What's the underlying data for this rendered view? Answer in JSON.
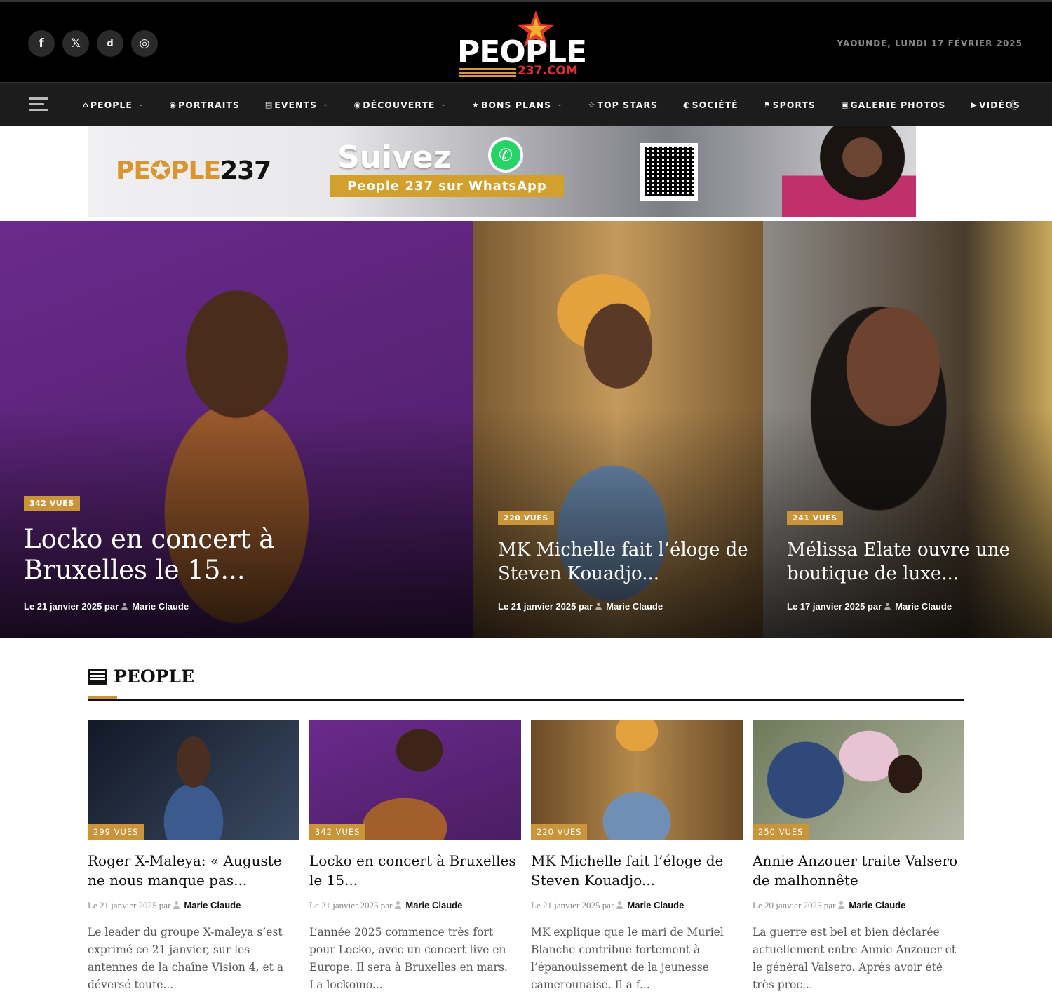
{
  "header": {
    "social": [
      {
        "icon": "facebook-icon",
        "glyph": "f"
      },
      {
        "icon": "x-icon",
        "glyph": "𝕏"
      },
      {
        "icon": "dailymotion-icon",
        "glyph": "d"
      },
      {
        "icon": "instagram-icon",
        "glyph": "◎"
      }
    ],
    "logo_word": "PEOPLE",
    "logo_domain": "237.COM",
    "date": "YAOUNDÉ, LUNDI 17 FÉVRIER 2025"
  },
  "nav": {
    "items": [
      {
        "icon": "⌂",
        "label": "PEOPLE",
        "dropdown": "⌄"
      },
      {
        "icon": "◉",
        "label": "PORTRAITS"
      },
      {
        "icon": "▤",
        "label": "EVENTS",
        "dropdown": "⌄"
      },
      {
        "icon": "◉",
        "label": "DÉCOUVERTE",
        "dropdown": "⌄"
      },
      {
        "icon": "★",
        "label": "BONS PLANS",
        "dropdown": "⌄"
      },
      {
        "icon": "☆",
        "label": "TOP STARS"
      },
      {
        "icon": "◐",
        "label": "SOCIÉTÉ"
      },
      {
        "icon": "⚑",
        "label": "SPORTS"
      },
      {
        "icon": "▣",
        "label": "GALERIE PHOTOS"
      },
      {
        "icon": "▶",
        "label": "VIDÉOS"
      }
    ],
    "theme_toggle": "☾"
  },
  "banner": {
    "logo_a": "PE✪PLE",
    "logo_b": "237",
    "headline": "Suivez",
    "bar": "People 237 sur WhatsApp",
    "wa_glyph": "✆"
  },
  "hero": [
    {
      "views": "342 VUES",
      "title": "Locko en concert à Bruxelles le 15...",
      "date": "Le 21 janvier 2025 par",
      "author": "Marie Claude"
    },
    {
      "views": "220 VUES",
      "title": "MK Michelle fait l’éloge de Steven Kouadjo...",
      "date": "Le 21 janvier 2025 par",
      "author": "Marie Claude"
    },
    {
      "views": "241 VUES",
      "title": "Mélissa Elate ouvre une boutique de luxe...",
      "date": "Le 17 janvier 2025 par",
      "author": "Marie Claude"
    }
  ],
  "section": {
    "title": "PEOPLE",
    "cards": [
      {
        "views": "299 VUES",
        "title": "Roger X-Maleya: « Auguste ne nous manque pas...",
        "date": "Le 21 janvier 2025 par",
        "author": "Marie Claude",
        "excerpt": "Le leader du groupe X-maleya s’est exprimé ce 21 janvier, sur les antennes de la chaîne Vision 4, et a déversé toute..."
      },
      {
        "views": "342 VUES",
        "title": "Locko en concert à Bruxelles le 15...",
        "date": "Le 21 janvier 2025 par",
        "author": "Marie Claude",
        "excerpt": "L’année 2025 commence très fort pour Locko, avec un concert live en Europe. Il sera à Bruxelles en mars.  La lockomo..."
      },
      {
        "views": "220 VUES",
        "title": "MK Michelle fait l’éloge de Steven Kouadjo...",
        "date": "Le 21 janvier 2025 par",
        "author": "Marie Claude",
        "excerpt": "MK explique que le mari de Muriel Blanche contribue fortement à l’épanouissement de la jeunesse camerounaise. Il a f..."
      },
      {
        "views": "250 VUES",
        "title": "Annie Anzouer traite Valsero de malhonnête",
        "date": "Le 20 janvier 2025 par",
        "author": "Marie Claude",
        "excerpt": "La guerre est bel et bien déclarée actuellement entre Annie Anzouer et le général Valsero. Après avoir été très proc..."
      }
    ]
  },
  "colors": {
    "accent": "#c9943a",
    "header_bg": "#000000",
    "nav_bg": "#1c1c1c"
  }
}
